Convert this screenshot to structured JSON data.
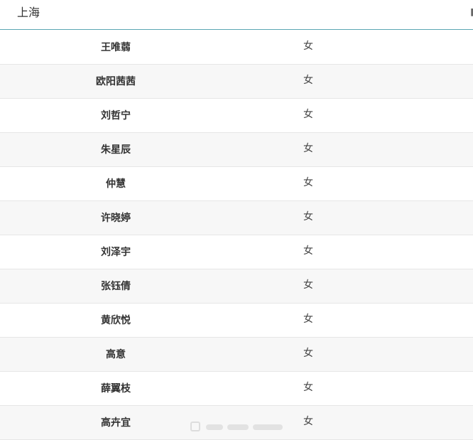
{
  "header": {
    "region_title": "上海"
  },
  "rows": [
    {
      "name": "王唯蒻",
      "gender": "女"
    },
    {
      "name": "欧阳茜茜",
      "gender": "女"
    },
    {
      "name": "刘哲宁",
      "gender": "女"
    },
    {
      "name": "朱星辰",
      "gender": "女"
    },
    {
      "name": "仲慧",
      "gender": "女"
    },
    {
      "name": "许晓婷",
      "gender": "女"
    },
    {
      "name": "刘泽宇",
      "gender": "女"
    },
    {
      "name": "张钰倩",
      "gender": "女"
    },
    {
      "name": "黄欣悦",
      "gender": "女"
    },
    {
      "name": "高意",
      "gender": "女"
    },
    {
      "name": "薛翼枝",
      "gender": "女"
    },
    {
      "name": "高卉宜",
      "gender": "女"
    }
  ]
}
